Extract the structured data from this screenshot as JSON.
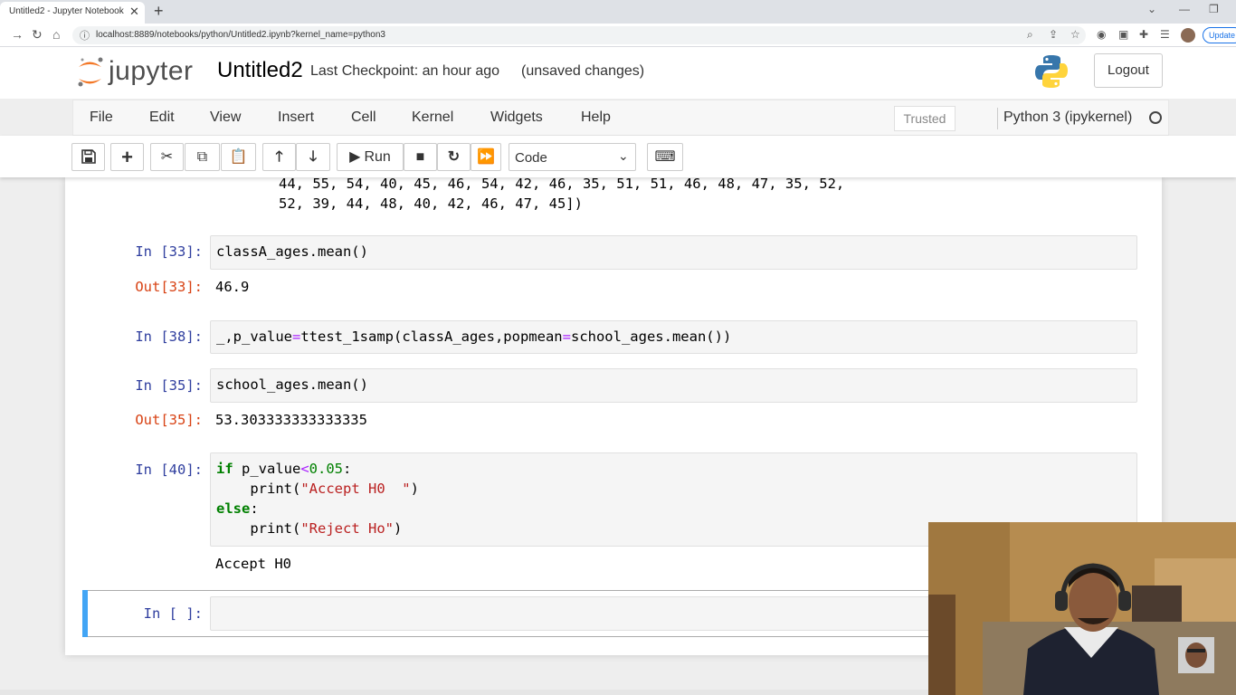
{
  "browser": {
    "tab_title": "Untitled2 - Jupyter Notebook",
    "url": "localhost:8889/notebooks/python/Untitled2.ipynb?kernel_name=python3",
    "update_label": "Update"
  },
  "header": {
    "logo_text": "jupyter",
    "notebook_name": "Untitled2",
    "checkpoint": "Last Checkpoint: an hour ago",
    "unsaved": "(unsaved changes)",
    "logout_label": "Logout"
  },
  "menubar": {
    "items": [
      "File",
      "Edit",
      "View",
      "Insert",
      "Cell",
      "Kernel",
      "Widgets",
      "Help"
    ],
    "trusted_label": "Trusted",
    "kernel_name": "Python 3 (ipykernel)"
  },
  "toolbar": {
    "run_label": "Run",
    "cell_type": "Code"
  },
  "cells": {
    "prev_output": {
      "line1": "44, 55, 54, 40, 45, 46, 54, 42, 46, 35, 51, 51, 46, 48, 47, 35, 52,",
      "line2": "52, 39, 44, 48, 40, 42, 46, 47, 45])"
    },
    "c33": {
      "prompt_in": "In [33]:",
      "code": "classA_ages.mean()",
      "prompt_out": "Out[33]:",
      "output": "46.9"
    },
    "c38": {
      "prompt_in": "In [38]:",
      "code_a": "_,p_value",
      "code_op1": "=",
      "code_b": "ttest_1samp(classA_ages,popmean",
      "code_op2": "=",
      "code_c": "school_ages.mean())"
    },
    "c35": {
      "prompt_in": "In [35]:",
      "code": "school_ages.mean()",
      "prompt_out": "Out[35]:",
      "output": "53.303333333333335"
    },
    "c40": {
      "prompt_in": "In [40]:",
      "l1_kw": "if",
      "l1_a": " p_value",
      "l1_op": "<",
      "l1_num": "0.05",
      "l1_end": ":",
      "l2_a": "    print(",
      "l2_str": "\"Accept H0  \"",
      "l2_end": ")",
      "l3_kw": "else",
      "l3_end": ":",
      "l4_a": "    print(",
      "l4_str": "\"Reject Ho\"",
      "l4_end": ")",
      "output": "Accept H0"
    },
    "empty": {
      "prompt_in": "In [ ]:"
    }
  }
}
